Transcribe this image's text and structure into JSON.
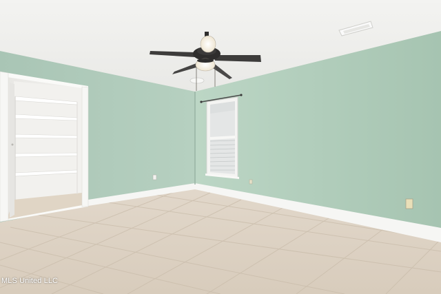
{
  "photo": {
    "watermark": "MLS United LLC"
  }
}
